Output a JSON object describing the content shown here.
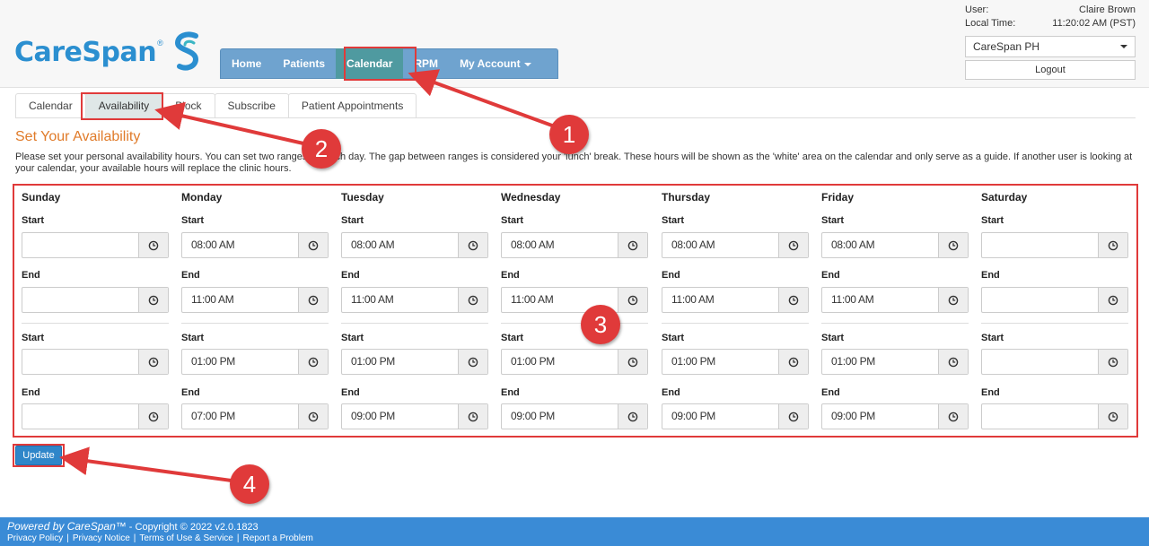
{
  "brand": {
    "name": "CareSpan",
    "reg": "®",
    "accent": "#2b8fd0"
  },
  "nav": {
    "items": [
      {
        "label": "Home"
      },
      {
        "label": "Patients"
      },
      {
        "label": "Calendar",
        "active": true
      },
      {
        "label": "RPM"
      },
      {
        "label": "My Account"
      }
    ]
  },
  "user": {
    "user_label": "User:",
    "user_value": "Claire Brown",
    "time_label": "Local Time:",
    "time_value": "11:20:02 AM (PST)",
    "clinic": "CareSpan PH",
    "logout": "Logout"
  },
  "subtabs": [
    {
      "label": "Calendar"
    },
    {
      "label": "Availability",
      "active": true
    },
    {
      "label": "Block"
    },
    {
      "label": "Subscribe"
    },
    {
      "label": "Patient Appointments"
    }
  ],
  "section": {
    "title": "Set Your Availability",
    "help": "Please set your personal availability hours. You can set two ranges for each day. The gap between ranges is considered your 'lunch' break. These hours will be shown as the 'white' area on the calendar and only serve as a guide. If another user is looking at your calendar, your available hours will replace the clinic hours."
  },
  "labels": {
    "start": "Start",
    "end": "End"
  },
  "days": [
    {
      "name": "Sunday",
      "r1_start": "",
      "r1_end": "",
      "r2_start": "",
      "r2_end": ""
    },
    {
      "name": "Monday",
      "r1_start": "08:00 AM",
      "r1_end": "11:00 AM",
      "r2_start": "01:00 PM",
      "r2_end": "07:00 PM"
    },
    {
      "name": "Tuesday",
      "r1_start": "08:00 AM",
      "r1_end": "11:00 AM",
      "r2_start": "01:00 PM",
      "r2_end": "09:00 PM"
    },
    {
      "name": "Wednesday",
      "r1_start": "08:00 AM",
      "r1_end": "11:00 AM",
      "r2_start": "01:00 PM",
      "r2_end": "09:00 PM"
    },
    {
      "name": "Thursday",
      "r1_start": "08:00 AM",
      "r1_end": "11:00 AM",
      "r2_start": "01:00 PM",
      "r2_end": "09:00 PM"
    },
    {
      "name": "Friday",
      "r1_start": "08:00 AM",
      "r1_end": "11:00 AM",
      "r2_start": "01:00 PM",
      "r2_end": "09:00 PM"
    },
    {
      "name": "Saturday",
      "r1_start": "",
      "r1_end": "",
      "r2_start": "",
      "r2_end": ""
    }
  ],
  "update_label": "Update",
  "footer": {
    "powered": "Powered by CareSpan™",
    "copyright": " - Copyright © 2022 v2.0.1823",
    "links": [
      "Privacy Policy",
      "Privacy Notice",
      "Terms of Use & Service",
      "Report a Problem"
    ]
  },
  "annotations": {
    "color": "#e03a3a",
    "steps": [
      "1",
      "2",
      "3",
      "4"
    ]
  },
  "icons": {
    "clock": "clock-icon",
    "caret": "caret-down-icon",
    "logo": "carespan-s-logo-icon"
  }
}
